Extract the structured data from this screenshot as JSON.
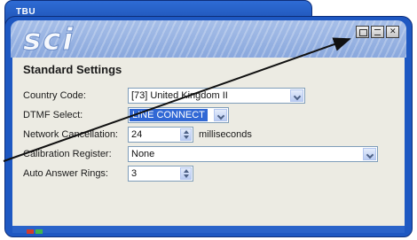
{
  "window": {
    "title": "TBU",
    "logo": "sci"
  },
  "settings": {
    "section_title": "Standard Settings",
    "country_code": {
      "label": "Country Code:",
      "value": "[73] United Kingdom II"
    },
    "dtmf_select": {
      "label": "DTMF Select:",
      "value": "LINE CONNECT"
    },
    "network_cancellation": {
      "label": "Network Cancellation:",
      "value": "24",
      "unit": "milliseconds"
    },
    "calibration_register": {
      "label": "Calibration Register:",
      "value": "None"
    },
    "auto_answer_rings": {
      "label": "Auto Answer Rings:",
      "value": "3"
    }
  },
  "colors": {
    "frame": "#1e58c2",
    "panel": "#ecebe3",
    "selection": "#3168d5"
  },
  "icons": [
    "minimize-icon",
    "maximize-icon",
    "close-icon",
    "chevron-down-icon",
    "spinner-icon"
  ]
}
